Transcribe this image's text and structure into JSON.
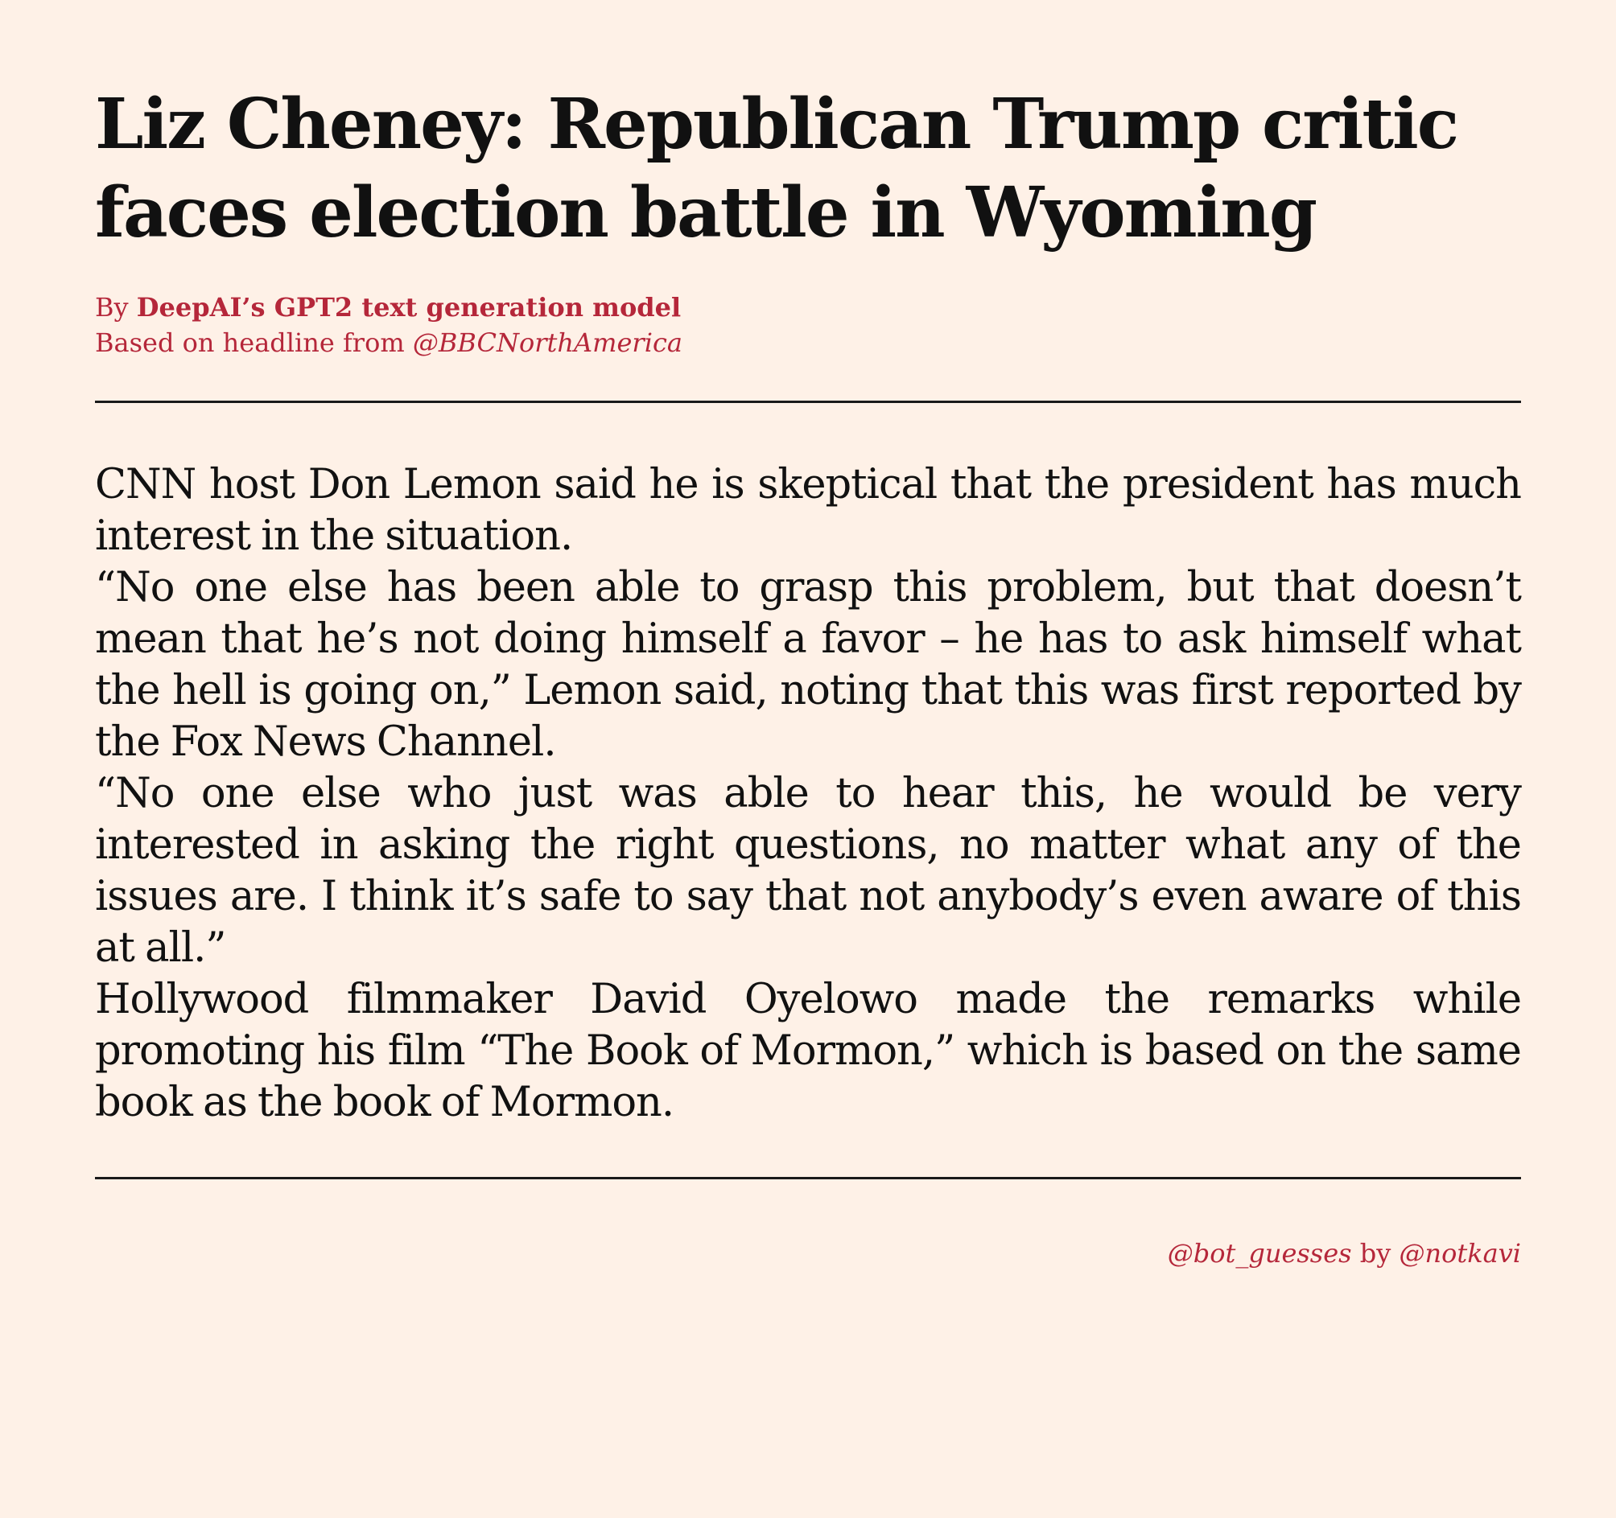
{
  "article": {
    "headline": "Liz Cheney: Republican Trump critic faces election battle in Wyoming",
    "byline": {
      "prefix": "By ",
      "author": "DeepAI’s GPT2 text generation model",
      "source_prefix": "Based on headline from ",
      "source_handle": "@BBCNorthAmerica"
    },
    "paragraphs": [
      "CNN host Don Lemon said he is skeptical that the president has much interest in the situation.",
      "“No one else has been able to grasp this problem, but that doesn’t mean that he’s not doing himself a favor – he has to ask himself what the hell is going on,” Lemon said, noting that this was first reported by the Fox News Channel.",
      "“No one else who just was able to hear this, he would be very interested in asking the right questions, no matter what any of the issues are. I think it’s safe to say that not anybody’s even aware of this at all.”",
      "Hollywood filmmaker David Oyelowo made the remarks while promoting his film “The Book of Mormon,” which is based on the same book as the book of Mormon."
    ]
  },
  "footer": {
    "bot_handle": "@bot_guesses",
    "by_text": " by ",
    "author_handle": "@notkavi"
  },
  "colors": {
    "background": "#fef1e7",
    "accent": "#b5273a",
    "text": "#111111"
  }
}
